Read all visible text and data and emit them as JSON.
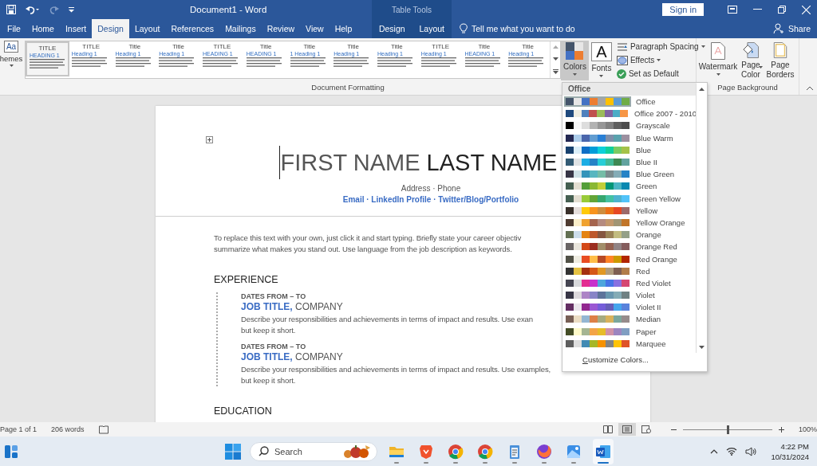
{
  "title_bar": {
    "title": "Document1  -  Word",
    "context_title": "Table Tools",
    "sign_in": "Sign in"
  },
  "tabs": [
    {
      "label": "File",
      "selected": false,
      "kind": "main"
    },
    {
      "label": "Home",
      "selected": false,
      "kind": "main"
    },
    {
      "label": "Insert",
      "selected": false,
      "kind": "main"
    },
    {
      "label": "Design",
      "selected": true,
      "kind": "main"
    },
    {
      "label": "Layout",
      "selected": false,
      "kind": "main"
    },
    {
      "label": "References",
      "selected": false,
      "kind": "main"
    },
    {
      "label": "Mailings",
      "selected": false,
      "kind": "main"
    },
    {
      "label": "Review",
      "selected": false,
      "kind": "main"
    },
    {
      "label": "View",
      "selected": false,
      "kind": "main"
    },
    {
      "label": "Help",
      "selected": false,
      "kind": "main"
    },
    {
      "label": "Design",
      "selected": false,
      "kind": "contextual"
    },
    {
      "label": "Layout",
      "selected": false,
      "kind": "contextual"
    }
  ],
  "tell_me": "Tell me what you want to do",
  "share": "Share",
  "ribbon": {
    "themes_glyph": "Aa",
    "themes": "hemes",
    "gallery": [
      {
        "title": "TITLE",
        "heading": "HEADING 1",
        "selected": true
      },
      {
        "title": "TITLE",
        "heading": "Heading 1",
        "selected": false
      },
      {
        "title": "Title",
        "heading": "Heading 1",
        "selected": false
      },
      {
        "title": "Title",
        "heading": "Heading 1",
        "selected": false
      },
      {
        "title": "TITLE",
        "heading": "HEADING 1",
        "selected": false
      },
      {
        "title": "Title",
        "heading": "HEADING 1",
        "selected": false
      },
      {
        "title": "Title",
        "heading": "1   Heading 1",
        "selected": false
      },
      {
        "title": "Title",
        "heading": "Heading 1",
        "selected": false
      },
      {
        "title": "Title",
        "heading": "Heading 1",
        "selected": false
      },
      {
        "title": "TITLE",
        "heading": "Heading 1",
        "selected": false
      },
      {
        "title": "Title",
        "heading": "HEADING 1",
        "selected": false
      },
      {
        "title": "Title",
        "heading": "Heading 1",
        "selected": false
      }
    ],
    "colors": "Colors",
    "colors_pressed": true,
    "fonts_glyph": "A",
    "fonts": "Fonts",
    "paragraph_spacing": "Paragraph Spacing",
    "effects": "Effects",
    "set_default": "Set as Default",
    "document_group": "Document Formatting",
    "watermark": "Watermark",
    "page_color": "Page Color",
    "page_borders": "Page Borders",
    "background_group": "Page Background"
  },
  "colors_menu": {
    "header": "Office",
    "customize": "Customize Colors...",
    "palettes": [
      {
        "name": "Office",
        "selected": true,
        "colors": [
          {
            "color": "#44546a"
          },
          {
            "color": "#e7e6e6"
          },
          {
            "color": "#4472c4"
          },
          {
            "color": "#ed7d31"
          },
          {
            "color": "#a5a5a5"
          },
          {
            "color": "#ffc000"
          },
          {
            "color": "#5b9bd5"
          },
          {
            "color": "#70ad47"
          }
        ]
      },
      {
        "name": "Office 2007 - 2010",
        "selected": false,
        "colors": [
          {
            "color": "#1f497d"
          },
          {
            "color": "#eeece1"
          },
          {
            "color": "#4f81bd"
          },
          {
            "color": "#c0504d"
          },
          {
            "color": "#9bbb59"
          },
          {
            "color": "#8064a2"
          },
          {
            "color": "#4bacc6"
          },
          {
            "color": "#f79646"
          }
        ]
      },
      {
        "name": "Grayscale",
        "selected": false,
        "colors": [
          {
            "color": "#000000"
          },
          {
            "color": "#f8f8f8"
          },
          {
            "color": "#dddddd"
          },
          {
            "color": "#b2b2b2"
          },
          {
            "color": "#969696"
          },
          {
            "color": "#808080"
          },
          {
            "color": "#5f5f5f"
          },
          {
            "color": "#4d4d4d"
          }
        ]
      },
      {
        "name": "Blue Warm",
        "selected": false,
        "colors": [
          {
            "color": "#242852"
          },
          {
            "color": "#acccea"
          },
          {
            "color": "#4a66ac"
          },
          {
            "color": "#629dd1"
          },
          {
            "color": "#297fd5"
          },
          {
            "color": "#7f8fa9"
          },
          {
            "color": "#5aa2ae"
          },
          {
            "color": "#9d90a0"
          }
        ]
      },
      {
        "name": "Blue",
        "selected": false,
        "colors": [
          {
            "color": "#17406d"
          },
          {
            "color": "#dbeff9"
          },
          {
            "color": "#0f6fc6"
          },
          {
            "color": "#009dd9"
          },
          {
            "color": "#0bd0d9"
          },
          {
            "color": "#10cf9b"
          },
          {
            "color": "#7cca62"
          },
          {
            "color": "#a5c249"
          }
        ]
      },
      {
        "name": "Blue II",
        "selected": false,
        "colors": [
          {
            "color": "#335b74"
          },
          {
            "color": "#dfe3e5"
          },
          {
            "color": "#1cade4"
          },
          {
            "color": "#2683c6"
          },
          {
            "color": "#27ced7"
          },
          {
            "color": "#42ba97"
          },
          {
            "color": "#3e8853"
          },
          {
            "color": "#62a39f"
          }
        ]
      },
      {
        "name": "Blue Green",
        "selected": false,
        "colors": [
          {
            "color": "#373545"
          },
          {
            "color": "#cee0e5"
          },
          {
            "color": "#3494ba"
          },
          {
            "color": "#58b6c0"
          },
          {
            "color": "#75bda7"
          },
          {
            "color": "#7a8c8e"
          },
          {
            "color": "#84acb6"
          },
          {
            "color": "#2683c6"
          }
        ]
      },
      {
        "name": "Green",
        "selected": false,
        "colors": [
          {
            "color": "#455f51"
          },
          {
            "color": "#e3ded1"
          },
          {
            "color": "#549e39"
          },
          {
            "color": "#8ab833"
          },
          {
            "color": "#c0cf3a"
          },
          {
            "color": "#029676"
          },
          {
            "color": "#4ab5c4"
          },
          {
            "color": "#0989b1"
          }
        ]
      },
      {
        "name": "Green Yellow",
        "selected": false,
        "colors": [
          {
            "color": "#455f51"
          },
          {
            "color": "#e3ded1"
          },
          {
            "color": "#99cb38"
          },
          {
            "color": "#63a537"
          },
          {
            "color": "#37a76f"
          },
          {
            "color": "#44c1a3"
          },
          {
            "color": "#4eb3cf"
          },
          {
            "color": "#51c3f9"
          }
        ]
      },
      {
        "name": "Yellow",
        "selected": false,
        "colors": [
          {
            "color": "#39302a"
          },
          {
            "color": "#e5dedb"
          },
          {
            "color": "#ffca08"
          },
          {
            "color": "#f8931d"
          },
          {
            "color": "#ce8d3e"
          },
          {
            "color": "#ec7016"
          },
          {
            "color": "#e64823"
          },
          {
            "color": "#9c6a6a"
          }
        ]
      },
      {
        "name": "Yellow Orange",
        "selected": false,
        "colors": [
          {
            "color": "#4e3b30"
          },
          {
            "color": "#fbeec9"
          },
          {
            "color": "#f0a22e"
          },
          {
            "color": "#a5644e"
          },
          {
            "color": "#b58b80"
          },
          {
            "color": "#c3986d"
          },
          {
            "color": "#a19574"
          },
          {
            "color": "#c17529"
          }
        ]
      },
      {
        "name": "Orange",
        "selected": false,
        "colors": [
          {
            "color": "#637052"
          },
          {
            "color": "#ccddea"
          },
          {
            "color": "#e48312"
          },
          {
            "color": "#bd582c"
          },
          {
            "color": "#865640"
          },
          {
            "color": "#9b8357"
          },
          {
            "color": "#c2bc80"
          },
          {
            "color": "#94a088"
          }
        ]
      },
      {
        "name": "Orange Red",
        "selected": false,
        "colors": [
          {
            "color": "#696464"
          },
          {
            "color": "#e9e5dc"
          },
          {
            "color": "#d34817"
          },
          {
            "color": "#9b2d1f"
          },
          {
            "color": "#a28e6a"
          },
          {
            "color": "#956251"
          },
          {
            "color": "#918485"
          },
          {
            "color": "#855d5d"
          }
        ]
      },
      {
        "name": "Red Orange",
        "selected": false,
        "colors": [
          {
            "color": "#505046"
          },
          {
            "color": "#eeece1"
          },
          {
            "color": "#e84c22"
          },
          {
            "color": "#ffbd47"
          },
          {
            "color": "#b64926"
          },
          {
            "color": "#ff8427"
          },
          {
            "color": "#cc9900"
          },
          {
            "color": "#b22600"
          }
        ]
      },
      {
        "name": "Red",
        "selected": false,
        "colors": [
          {
            "color": "#323232"
          },
          {
            "color": "#e5c243"
          },
          {
            "color": "#a5300f"
          },
          {
            "color": "#d55816"
          },
          {
            "color": "#e19825"
          },
          {
            "color": "#b19c7d"
          },
          {
            "color": "#7f5f52"
          },
          {
            "color": "#b27d49"
          }
        ]
      },
      {
        "name": "Red Violet",
        "selected": false,
        "colors": [
          {
            "color": "#454551"
          },
          {
            "color": "#d8d9dc"
          },
          {
            "color": "#e32d91"
          },
          {
            "color": "#c830cc"
          },
          {
            "color": "#4ea6dc"
          },
          {
            "color": "#4775e7"
          },
          {
            "color": "#8971e1"
          },
          {
            "color": "#d54773"
          }
        ]
      },
      {
        "name": "Violet",
        "selected": false,
        "colors": [
          {
            "color": "#373545"
          },
          {
            "color": "#dcd8dc"
          },
          {
            "color": "#ad84c6"
          },
          {
            "color": "#8784c7"
          },
          {
            "color": "#5d739a"
          },
          {
            "color": "#6997af"
          },
          {
            "color": "#84acb6"
          },
          {
            "color": "#6f8183"
          }
        ]
      },
      {
        "name": "Violet II",
        "selected": false,
        "colors": [
          {
            "color": "#632e62"
          },
          {
            "color": "#eae5eb"
          },
          {
            "color": "#92278f"
          },
          {
            "color": "#9b57d3"
          },
          {
            "color": "#755dd9"
          },
          {
            "color": "#665eb8"
          },
          {
            "color": "#45a5ed"
          },
          {
            "color": "#5982db"
          }
        ]
      },
      {
        "name": "Median",
        "selected": false,
        "colors": [
          {
            "color": "#775f55"
          },
          {
            "color": "#ebddc3"
          },
          {
            "color": "#94b6d2"
          },
          {
            "color": "#dd8047"
          },
          {
            "color": "#a5ab81"
          },
          {
            "color": "#d8b25c"
          },
          {
            "color": "#7ba79d"
          },
          {
            "color": "#968c8c"
          }
        ]
      },
      {
        "name": "Paper",
        "selected": false,
        "colors": [
          {
            "color": "#444d26"
          },
          {
            "color": "#fefac9"
          },
          {
            "color": "#a5b592"
          },
          {
            "color": "#f3a447"
          },
          {
            "color": "#e7bc29"
          },
          {
            "color": "#d092a7"
          },
          {
            "color": "#9c85c0"
          },
          {
            "color": "#809ec2"
          }
        ]
      },
      {
        "name": "Marquee",
        "selected": false,
        "colors": [
          {
            "color": "#5e5e5e"
          },
          {
            "color": "#dddddd"
          },
          {
            "color": "#418ab3"
          },
          {
            "color": "#a6b727"
          },
          {
            "color": "#f69200"
          },
          {
            "color": "#838383"
          },
          {
            "color": "#fec306"
          },
          {
            "color": "#df5327"
          }
        ]
      }
    ]
  },
  "document": {
    "first_name": "FIRST NAME",
    "last_name": "LAST NAME",
    "contact": "Address · Phone",
    "links": "Email · LinkedIn Profile · Twitter/Blog/Portfolio",
    "objective": [
      "To replace this text with your own, just click it and start typing. Briefly state your career objectiv",
      "summarize what makes you stand out. Use language from the job description as keywords."
    ],
    "sections": [
      {
        "title": "EXPERIENCE",
        "entries": [
          {
            "dates": "DATES FROM – TO",
            "job_title": "JOB TITLE,",
            "company": "COMPANY",
            "description": [
              "Describe your responsibilities and achievements in terms of impact and results. Use exan",
              "but keep it short."
            ]
          },
          {
            "dates": "DATES FROM – TO",
            "job_title": "JOB TITLE,",
            "company": "COMPANY",
            "description": [
              "Describe your responsibilities and achievements in terms of impact and results. Use examples,",
              "but keep it short."
            ]
          }
        ]
      },
      {
        "title": "EDUCATION"
      }
    ]
  },
  "status_bar": {
    "page": "Page 1 of 1",
    "words": "206 words",
    "views": [
      {
        "kind": "read",
        "selected": false
      },
      {
        "kind": "print",
        "selected": true
      },
      {
        "kind": "web",
        "selected": false
      }
    ],
    "zoom_level": {
      "level": 0.5
    },
    "zoom": "100%"
  },
  "taskbar": {
    "search": "Search",
    "apps": [
      {
        "kind": "folder",
        "active": false
      },
      {
        "kind": "shield",
        "active": false
      },
      {
        "kind": "browser",
        "active": false
      },
      {
        "kind": "browser",
        "active": false
      },
      {
        "kind": "notepad",
        "active": false
      },
      {
        "kind": "fox",
        "active": false
      },
      {
        "kind": "photos",
        "active": false
      },
      {
        "kind": "word",
        "active": true
      }
    ],
    "time": "4:22 PM",
    "date": "10/31/2024"
  }
}
